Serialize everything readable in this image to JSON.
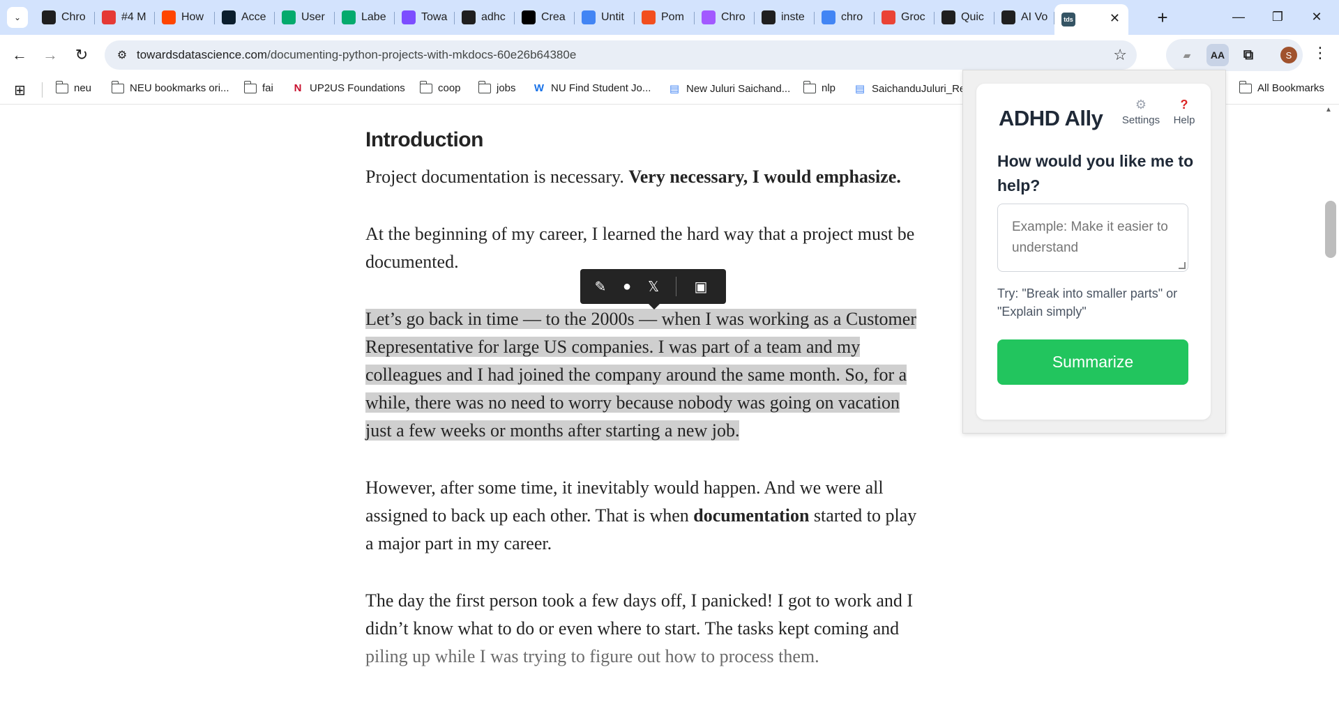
{
  "tabs": [
    {
      "label": "Chro",
      "icon": "chatgpt-icon",
      "color": "#1f1f1f"
    },
    {
      "label": "#4 M",
      "icon": "dots-icon",
      "color": "#e53935"
    },
    {
      "label": "How",
      "icon": "reddit-icon",
      "color": "#ff4500"
    },
    {
      "label": "Acce",
      "icon": "react-icon",
      "color": "#0b1e2d"
    },
    {
      "label": "User",
      "icon": "w3schools-icon",
      "color": "#04aa6d"
    },
    {
      "label": "Labe",
      "icon": "w3schools-icon",
      "color": "#04aa6d"
    },
    {
      "label": "Towa",
      "icon": "twitch-icon",
      "color": "#7c4dff"
    },
    {
      "label": "adhc",
      "icon": "github-icon",
      "color": "#1f1f1f"
    },
    {
      "label": "Crea",
      "icon": "medium-icon",
      "color": "#000000"
    },
    {
      "label": "Untit",
      "icon": "docs-icon",
      "color": "#4285f4"
    },
    {
      "label": "Pom",
      "icon": "figma-icon",
      "color": "#f24e1e"
    },
    {
      "label": "Chro",
      "icon": "figma-icon",
      "color": "#a259ff"
    },
    {
      "label": "inste",
      "icon": "openai-icon",
      "color": "#1f1f1f"
    },
    {
      "label": "chro",
      "icon": "google-icon",
      "color": "#4285f4"
    },
    {
      "label": "Groc",
      "icon": "badge-9-icon",
      "color": "#ea4335"
    },
    {
      "label": "Quic",
      "icon": "pause-icon",
      "color": "#1f1f1f"
    },
    {
      "label": "AI Vo",
      "icon": "pause-icon",
      "color": "#1f1f1f"
    }
  ],
  "active_tab": {
    "favicon_text": "tds",
    "close": "✕"
  },
  "window": {
    "new_tab": "+",
    "minimize": "—",
    "restore": "❐",
    "close": "✕"
  },
  "toolbar": {
    "url_domain": "towardsdatascience.com",
    "url_path": "/documenting-python-projects-with-mkdocs-60e26b64380e",
    "profile_initial": "S"
  },
  "bookmarks": {
    "items": [
      {
        "label": "neu",
        "type": "folder"
      },
      {
        "label": "NEU bookmarks ori...",
        "type": "folder"
      },
      {
        "label": "fai",
        "type": "folder"
      },
      {
        "label": "UP2US Foundations",
        "type": "link"
      },
      {
        "label": "coop",
        "type": "folder"
      },
      {
        "label": "jobs",
        "type": "folder"
      },
      {
        "label": "NU Find Student Jo...",
        "type": "link"
      },
      {
        "label": "New Juluri Saichand...",
        "type": "doc"
      },
      {
        "label": "nlp",
        "type": "folder"
      },
      {
        "label": "SaichanduJuluri_Res",
        "type": "doc"
      }
    ],
    "all_bookmarks": "All Bookmarks"
  },
  "article": {
    "heading": "Introduction",
    "p1_plain": "Project documentation is necessary. ",
    "p1_bold": "Very necessary, I would emphasize.",
    "p2_l1": "At the beginning of my career, I learned the hard way that a project must be",
    "p2_l2": "documented.",
    "p3_l1": "Let’s go back in time — to the 2000s — when I was working as a Customer",
    "p3_l2": "Representative for large US companies. I was part of a team and my",
    "p3_l3": "colleagues and I had joined the company around the same month. So, for a",
    "p3_l4": "while, there was no need to worry because nobody was going on vacation",
    "p3_l5": "just a few weeks or months after starting a new job.",
    "p4_l1": "However, after some time, it inevitably would happen. And we were all",
    "p4_l2a": "assigned to back up each other. That is when ",
    "p4_l2b": "documentation",
    "p4_l2c": " started to play",
    "p4_l3": "a major part in my career.",
    "p5_l1": "The day the first person took a few days off, I panicked! I got to work and I",
    "p5_l2": "didn’t know what to do or even where to start. The tasks kept coming and",
    "p5_l3": "piling up while I was trying to figure out how to process them."
  },
  "popup": {
    "title": "ADHD Ally",
    "settings_label": "Settings",
    "help_label": "Help",
    "question": "How would you like me to help?",
    "input_placeholder": "Example: Make it easier to understand",
    "hint": "Try: \"Break into smaller parts\" or \"Explain simply\"",
    "button_label": "Summarize",
    "accent": "#22c55e"
  }
}
